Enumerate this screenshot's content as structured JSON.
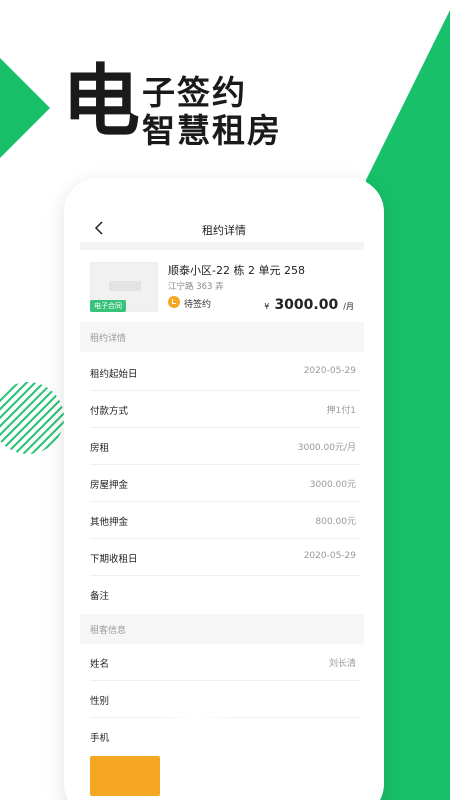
{
  "headline": {
    "big": "电",
    "line1": "子签约",
    "line2": "智慧租房"
  },
  "nav": {
    "title": "租约详情"
  },
  "listing": {
    "badge": "电子合同",
    "title": "顺泰小区-22 栋 2 单元 258",
    "address": "江宁路 363 弄",
    "status": "待签约",
    "price_currency": "¥",
    "price": "3000.00",
    "price_unit": "/月"
  },
  "sections": {
    "lease": "租约详情",
    "tenant": "租客信息"
  },
  "lease_rows": [
    {
      "label": "租约起始日",
      "value": "2020-05-29"
    },
    {
      "label": "付款方式",
      "value": "押1付1"
    },
    {
      "label": "房租",
      "value": "3000.00元/月"
    },
    {
      "label": "房屋押金",
      "value": "3000.00元"
    },
    {
      "label": "其他押金",
      "value": "800.00元"
    },
    {
      "label": "下期收租日",
      "value": "2020-05-29"
    },
    {
      "label": "备注",
      "value": ""
    }
  ],
  "tenant_rows": [
    {
      "label": "姓名",
      "value": "刘长清"
    },
    {
      "label": "性别",
      "value": ""
    },
    {
      "label": "手机",
      "value": ""
    }
  ],
  "colors": {
    "brand_green": "#18c06a",
    "accent_orange": "#f5a623"
  },
  "icons": {
    "back": "chevron-left-icon",
    "status": "clock-icon"
  }
}
